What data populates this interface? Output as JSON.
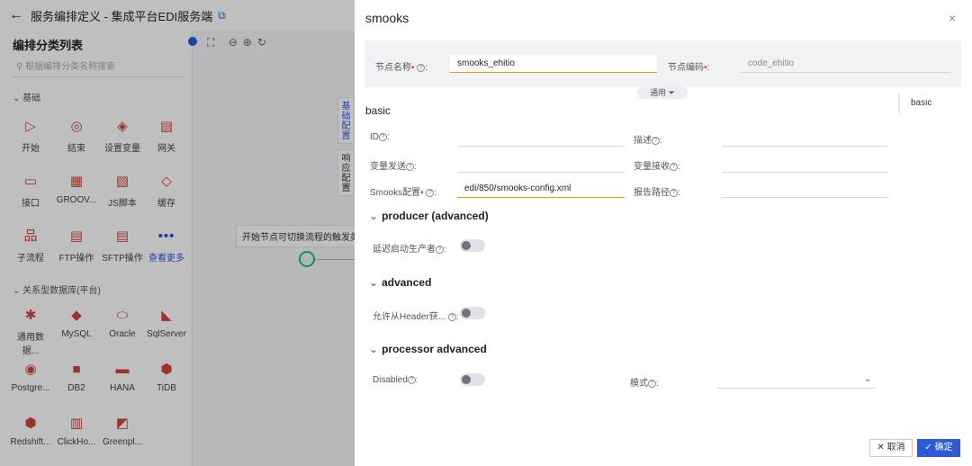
{
  "topbar": {
    "title": "服务编排定义 - 集成平台EDI服务端"
  },
  "left_panel": {
    "title": "编排分类列表",
    "search_placeholder": "根据编排分类名称搜索",
    "group_basic": "基础",
    "group_db": "关系型数据库(平台)",
    "basic_tools": [
      {
        "label": "开始",
        "icon": "▷"
      },
      {
        "label": "结束",
        "icon": "◎"
      },
      {
        "label": "设置变量",
        "icon": "◈"
      },
      {
        "label": "网关",
        "icon": "▤"
      },
      {
        "label": "接口",
        "icon": "▭"
      },
      {
        "label": "GROOV...",
        "icon": "▦"
      },
      {
        "label": "JS脚本",
        "icon": "▧"
      },
      {
        "label": "缓存",
        "icon": "◇"
      },
      {
        "label": "子流程",
        "icon": "品"
      },
      {
        "label": "FTP操作",
        "icon": "▤"
      },
      {
        "label": "SFTP操作",
        "icon": "▤"
      },
      {
        "label": "查看更多",
        "icon": "•••"
      }
    ],
    "db_tools": [
      {
        "label": "通用数据...",
        "icon": "✱"
      },
      {
        "label": "MySQL",
        "icon": "◆"
      },
      {
        "label": "Oracle",
        "icon": "⬭"
      },
      {
        "label": "SqlServer",
        "icon": "◣"
      },
      {
        "label": "Postgre...",
        "icon": "◉"
      },
      {
        "label": "DB2",
        "icon": "■"
      },
      {
        "label": "HANA",
        "icon": "▬"
      },
      {
        "label": "TiDB",
        "icon": "⬢"
      },
      {
        "label": "Redshift...",
        "icon": "⬢"
      },
      {
        "label": "ClickHo...",
        "icon": "▥"
      },
      {
        "label": "Greenpl...",
        "icon": "◩"
      }
    ]
  },
  "canvas": {
    "tip": "开始节点可切换流程的触发类型。",
    "side_tab_1": "基础配置",
    "side_tab_2": "响应配置"
  },
  "drawer": {
    "title": "smooks",
    "close": "×",
    "node_name_label": "节点名称",
    "node_name_value": "smooks_ehitio",
    "node_code_label": "节点编码",
    "node_code_value": "code_ehitio",
    "general_tab": "通用",
    "section_basic": "basic",
    "right_nav_item": "basic",
    "id_label": "ID",
    "desc_label": "描述",
    "var_send_label": "变量发送",
    "var_recv_label": "变量接收",
    "smooks_config_label": "Smooks配置",
    "smooks_config_value": "edi/850/smooks-config.xml",
    "report_path_label": "报告路径",
    "section_producer": "producer (advanced)",
    "delay_producer_label": "延迟启动生产者",
    "section_advanced": "advanced",
    "allow_header_label": "允许从Header获...",
    "section_processor": "processor advanced",
    "disabled_label": "Disabled",
    "mode_label": "模式",
    "cancel_button": "取消",
    "ok_button": "确定"
  },
  "colors": {
    "primary": "#2d5bd7",
    "required": "#ee3333",
    "focus_underline": "#e0a200"
  }
}
